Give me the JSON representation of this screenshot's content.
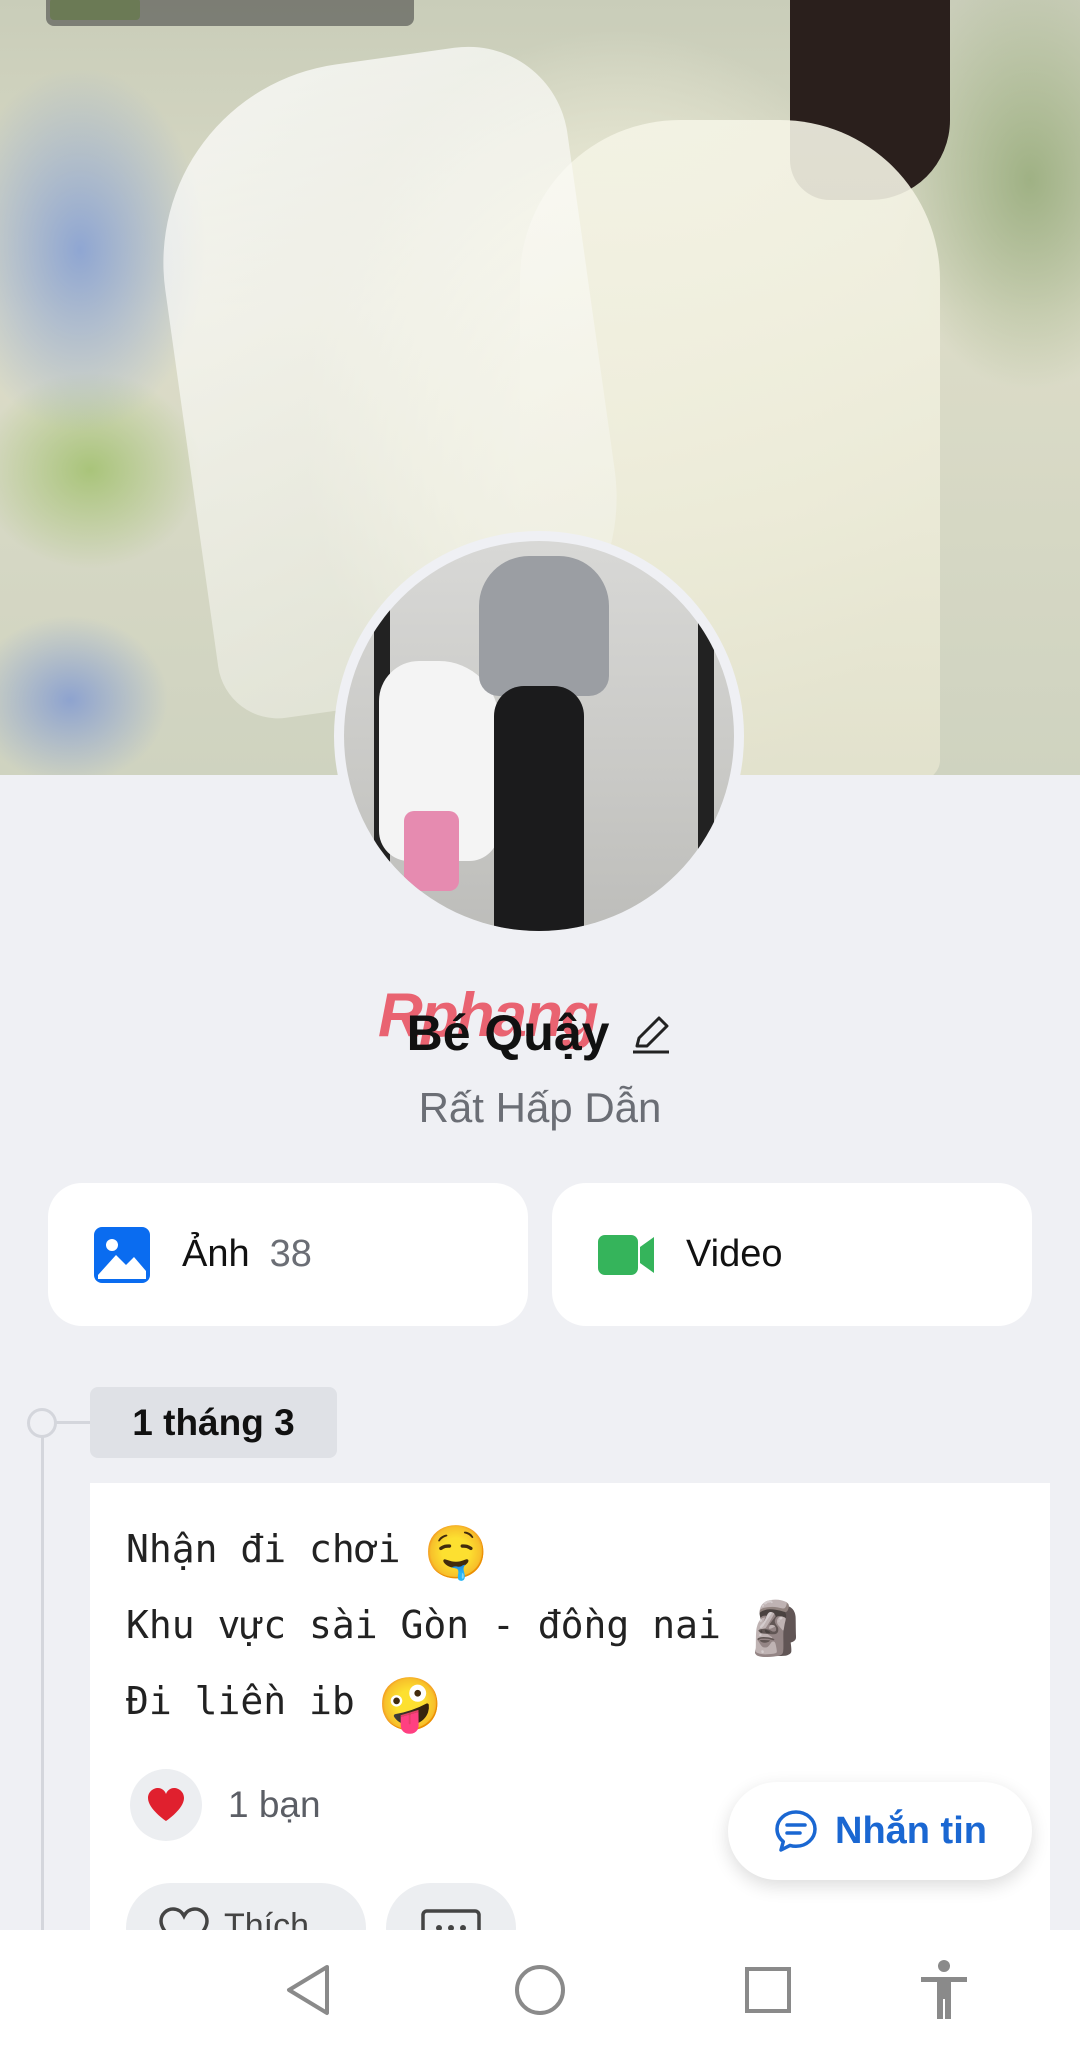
{
  "profile": {
    "name": "Bé Quậy",
    "subtitle": "Rất Hấp Dẫn",
    "watermark": "Rphang"
  },
  "media": {
    "photos": {
      "label": "Ảnh",
      "count": "38",
      "icon": "image-icon",
      "color": "#0a6cf0"
    },
    "videos": {
      "label": "Video",
      "icon": "video-camera-icon",
      "color": "#35b45b"
    }
  },
  "timeline": {
    "date": "1 tháng 3"
  },
  "post": {
    "lines": [
      "Nhận đi chơi",
      "Khu vực sài Gòn - đồng nai",
      "Đi liền ib"
    ],
    "emojis": [
      "🤤",
      "🗿",
      "🤪"
    ],
    "reaction_count": "1 bạn",
    "reaction_icon": "heart-icon",
    "like_label": "Thích"
  },
  "message_button": {
    "label": "Nhắn tin",
    "color": "#1a67d2"
  },
  "nav": {
    "icons": [
      "back-triangle-icon",
      "home-circle-icon",
      "recents-square-icon",
      "accessibility-icon"
    ]
  }
}
